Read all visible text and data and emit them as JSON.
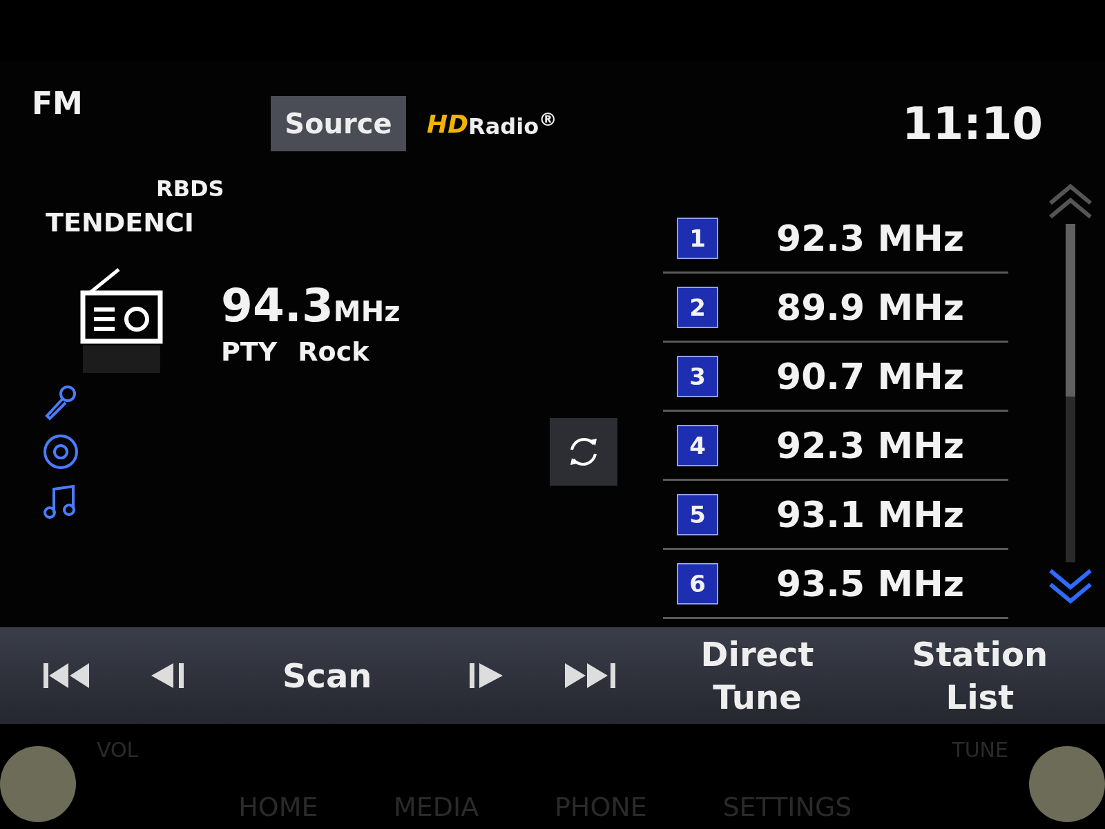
{
  "header": {
    "band": "FM",
    "source_button": "Source",
    "hd_logo": {
      "mark": "HD",
      "text": "Radio$^{®}$"
    },
    "clock": "11:10"
  },
  "station": {
    "rbds_label": "RBDS",
    "name": "TENDENCI",
    "frequency": "94.3",
    "unit": "MHz",
    "pty_label": "PTY",
    "pty_value": "Rock"
  },
  "presets": [
    {
      "number": "1",
      "frequency": "92.3 MHz"
    },
    {
      "number": "2",
      "frequency": "89.9 MHz"
    },
    {
      "number": "3",
      "frequency": "90.7 MHz"
    },
    {
      "number": "4",
      "frequency": "92.3 MHz"
    },
    {
      "number": "5",
      "frequency": "93.1 MHz"
    },
    {
      "number": "6",
      "frequency": "93.5 MHz"
    }
  ],
  "controls": [
    {
      "kind": "skip-back"
    },
    {
      "kind": "seek-back"
    },
    {
      "kind": "text",
      "label": "Scan"
    },
    {
      "kind": "seek-forward"
    },
    {
      "kind": "skip-forward"
    },
    {
      "kind": "text",
      "label": "Direct Tune"
    },
    {
      "kind": "text",
      "label": "Station List"
    }
  ],
  "bezel": {
    "left_knob": "VOL",
    "buttons": [
      "HOME",
      "MEDIA",
      "PHONE",
      "SETTINGS"
    ],
    "right_knob": "TUNE"
  }
}
